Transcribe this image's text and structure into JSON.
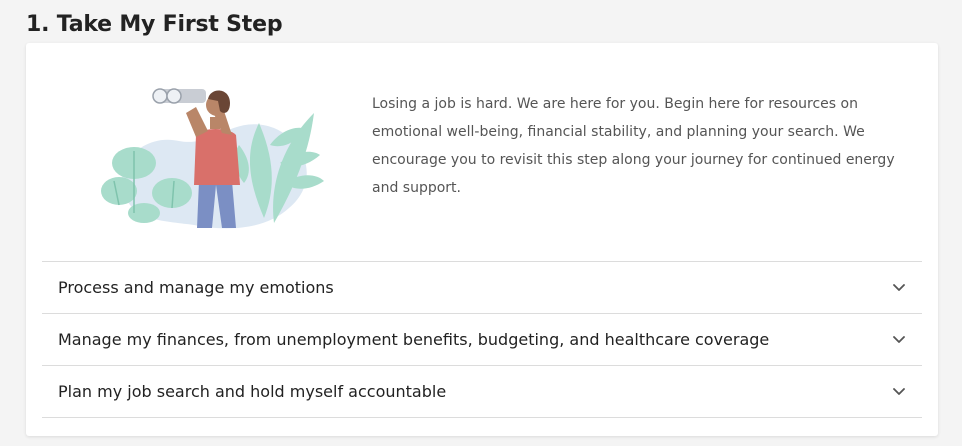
{
  "section": {
    "title": "1. Take My First Step"
  },
  "intro": {
    "text": "Losing a job is hard. We are here for you. Begin here for resources on emotional well-being, financial stability, and planning your search. We encourage you to revisit this step along your journey for continued energy and support.",
    "illustration": "person-with-binoculars-illustration"
  },
  "accordion": {
    "items": [
      {
        "label": "Process and manage my emotions",
        "icon": "chevron-down-icon",
        "expanded": false
      },
      {
        "label": "Manage my finances, from unemployment benefits, budgeting, and healthcare coverage",
        "icon": "chevron-down-icon",
        "expanded": false
      },
      {
        "label": "Plan my job search and hold myself accountable",
        "icon": "chevron-down-icon",
        "expanded": false
      }
    ]
  },
  "colors": {
    "leaf": "#a8dccb",
    "backdrop": "#dde8f3",
    "shirt": "#d9706a",
    "pants": "#7b8fc4",
    "skin": "#b98668",
    "text": "#555555"
  }
}
